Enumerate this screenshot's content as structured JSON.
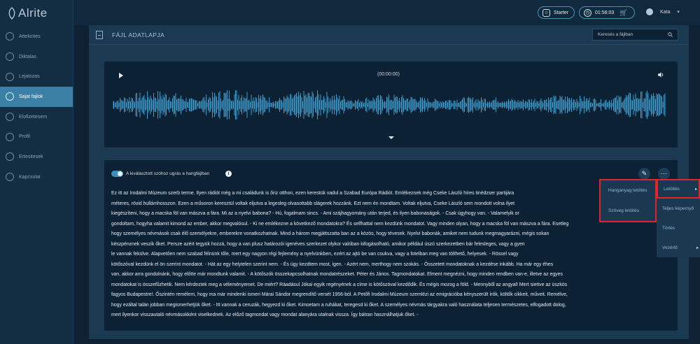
{
  "app": {
    "name": "Alrite"
  },
  "sidebar": {
    "items": [
      {
        "label": "Attekintes",
        "active": false
      },
      {
        "label": "Diktalas",
        "active": false
      },
      {
        "label": "Lejatszas",
        "active": false
      },
      {
        "label": "Sajat fajlok",
        "active": true
      },
      {
        "label": "Elofizetesem",
        "active": false
      },
      {
        "label": "Profil",
        "active": false
      },
      {
        "label": "Ertesitesek",
        "active": false
      },
      {
        "label": "Kapcsolat",
        "active": false
      }
    ]
  },
  "topbar": {
    "starter_label": "Starter",
    "timer_value": "01:56:03",
    "user_name": "Kata",
    "accent": "#4c90b6"
  },
  "panel": {
    "title": "FÁJL ADATLAPJA",
    "search_placeholder": "Keresés a fájlban"
  },
  "player": {
    "time": "(00:00:00)"
  },
  "transcript": {
    "toggle_label": "A kiválasztott szóhoz ugrás a hangfájlban",
    "toggle_on": true,
    "text": "Ez itt az Irodalmi Múzeum szerb terme. Ilyen rádiót még a mi családunk is őriz otthon, ezen kerestük vadul a Szabad Európa Rádiót. Emlékeznek még Cseke László híres tinédzser partijára\nméteres, rövid hullámhosszon. Ezen a műsoron keresztül voltak eljutva a legesleg olvasottabb slágerek hozzánk. Ezt nem én mondtam. Voltak eljutva, Cseke László sem mondott volna ilyet\nkiegészíteni, hogy a macska föl van mászva a fára. Mi az a nyelvi babona? - Hú, fogalmam sincs. - Ami szájhagyomány után terjed, és ilyen babonaságok. - Csak úgyhogy van. - Valamelyik or\ngondoltam, hogyha valamit kimond az ember, akkor megvalósul. - Ki ne emlékezne a következő mondatokra? És selfhattal nem kezdünk mondatot. Vagy minden olyan, hogy a macska föl van mászva a fára. Esetleg\nhogy személyes névmások csak élő személyekre, emberekre vonatkozhatnak. Mind a három megjáttszatta ban az a közös, hogy tévesek. Nyelvi babonák, amiket nem tudunk megmagyarázni, mégis sokan\nkészpénznek veszik őket. Persze azért tegyük hozzá, hogy a van plusz határozói igenéves szerkezet olykor valóban kifogásolható, amikor például úszó szerkezetben bár felesleges, vagy a gyen\nle vannak fekülve. Alapvetően nem szabad félnünk tőle, mert egy nagyon régi fejlemény a nyelvünkben, ezért az ajtó be van csukva, vagy a fotelban meg van tölthető, helyesek. - Rössel vagy\nkötőszóval kezdünk el ön szerint mondatot. - Hát az egy helytelen szerint nem. - És úgy kezdtem most, igen. - Azért nem, merthogy nem szokás. - Összetett mondatoknak a kezdése inkább. Ha már egy éhes\nvan, akkor arra gondolnánk, hogy előtte már mondtunk valamit. - A kötőszók összekapcsolhatnak mondatrészeket. Péter és János. Tagmondatokat. Elment megnézni, hogy minden rendben van-e, illetve az egyes\nmondatokat is összefűzhetik. Nem kérdeztek meg a véleményemet. De miért? Ráadásul Jókai egyik regényének a címe is kötőszóval kezdődik. És mégis mozog a föld. - Mennyből az angyal! Mert siettve az üszkös\nfagyos Budapestre!. Őszintén remélem, hogy ma már mindenki ismeri Márai Sándor megrendítő versét 1956-ból. A Petőfi Irodalmi Múzeum szemlézi az emigrációba kényszerült írók, költők cikkeit, műveit. Remélve,\nhogy ezáltal talán jobban megismerhetjük őket. - Itt vannak a ceruzák, hegyezd ki őket. Kimoetam a ruhákat, teregesd ki őket. A személyes névmás tárgyakra való használata teljesen természetes, elfogadott dolog,\nmert ilyenkor visszautaló névmásokként viselkednek. Az előző tagmondat vagy mondat alanyára utalnak vissza. Így bátran használhatjuk őket. -"
  },
  "menus": {
    "download_submenu": [
      "Hanganyag letöltés",
      "Szöveg letöltés"
    ],
    "actions": [
      {
        "label": "Letöltés",
        "has_arrow": true,
        "highlight": true
      },
      {
        "label": "Teljes képernyő",
        "has_arrow": false,
        "highlight": false
      },
      {
        "label": "Törlés",
        "has_arrow": false,
        "highlight": false
      },
      {
        "label": "Vezérlő",
        "has_arrow": true,
        "highlight": false
      }
    ],
    "highlight_color": "#e3242b"
  }
}
